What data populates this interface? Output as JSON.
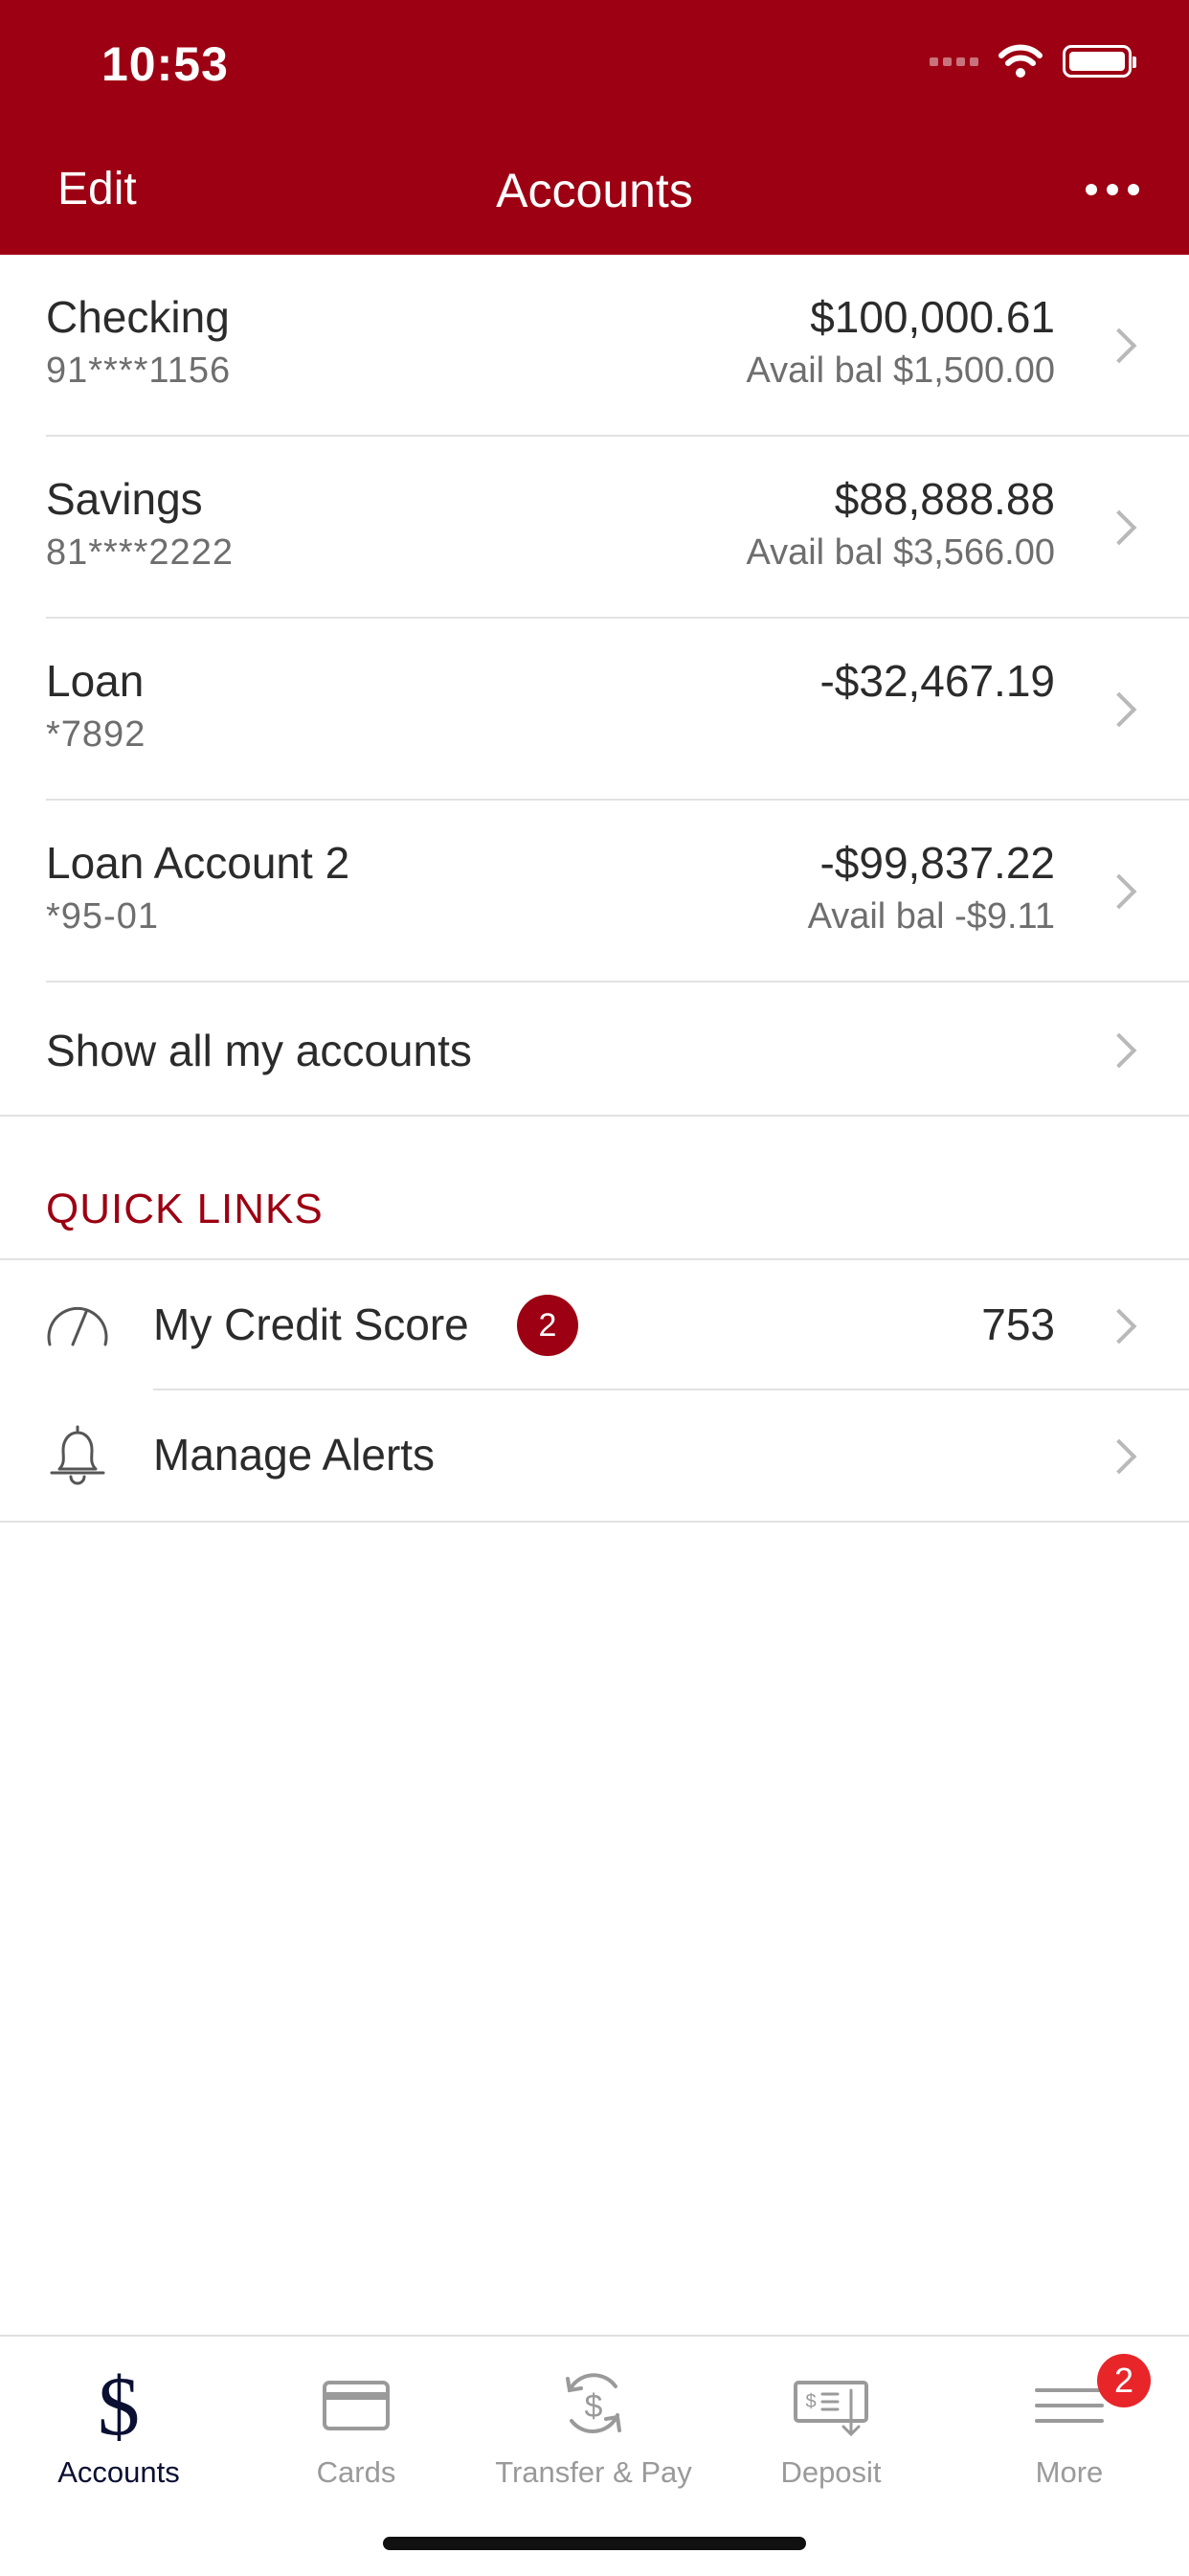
{
  "status_bar": {
    "time": "10:53"
  },
  "header": {
    "edit_label": "Edit",
    "title": "Accounts"
  },
  "accounts": [
    {
      "name": "Checking",
      "number": "91****1156",
      "balance": "$100,000.61",
      "avail": "Avail bal $1,500.00"
    },
    {
      "name": "Savings",
      "number": "81****2222",
      "balance": "$88,888.88",
      "avail": "Avail bal $3,566.00"
    },
    {
      "name": "Loan",
      "number": "*7892",
      "balance": "-$32,467.19",
      "avail": ""
    },
    {
      "name": "Loan Account 2",
      "number": "*95-01",
      "balance": "-$99,837.22",
      "avail": "Avail bal -$9.11"
    }
  ],
  "show_all_label": "Show all my accounts",
  "quick_links": {
    "title": "QUICK LINKS",
    "items": [
      {
        "label": "My Credit Score",
        "badge": "2",
        "value": "753",
        "icon": "speedometer-icon"
      },
      {
        "label": "Manage Alerts",
        "icon": "bell-icon"
      }
    ]
  },
  "tabbar": {
    "items": [
      {
        "label": "Accounts",
        "icon": "dollar-icon",
        "active": true
      },
      {
        "label": "Cards",
        "icon": "card-icon"
      },
      {
        "label": "Transfer & Pay",
        "icon": "transfer-icon"
      },
      {
        "label": "Deposit",
        "icon": "check-deposit-icon"
      },
      {
        "label": "More",
        "icon": "menu-icon",
        "badge": "2"
      }
    ]
  },
  "colors": {
    "brand": "#9c0012",
    "badge_red": "#e8262a",
    "active_tab": "#0b1033"
  }
}
